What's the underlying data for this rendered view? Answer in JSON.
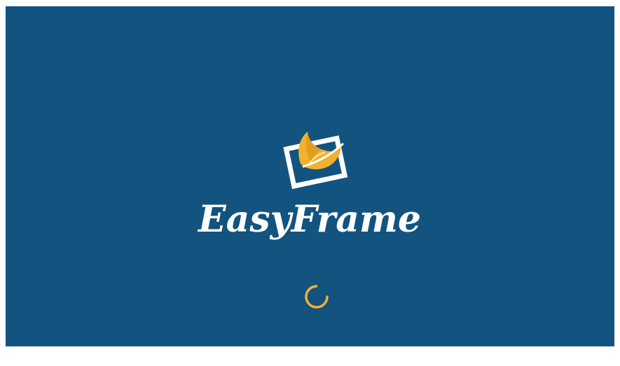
{
  "app": {
    "name": "EasyFrame"
  },
  "splash": {
    "logo_icon": "frame-with-feather-icon",
    "spinner_icon": "loading-spinner-icon"
  },
  "colors": {
    "background": "#125380",
    "logo_white": "#ffffff",
    "accent_orange": "#f2b12e",
    "accent_orange_dark": "#d38d12"
  }
}
